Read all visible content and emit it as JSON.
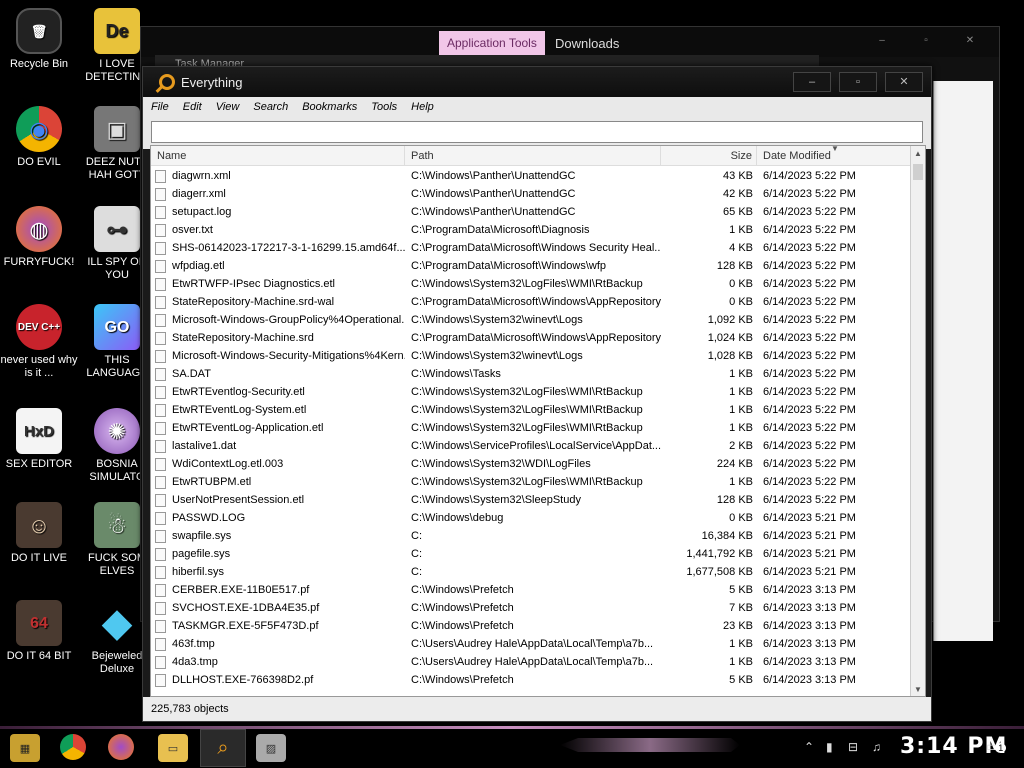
{
  "desktop": {
    "icons": [
      {
        "label": "Recycle Bin",
        "glyph": "🗑"
      },
      {
        "label": "I LOVE DETECTING",
        "glyph": "De"
      },
      {
        "label": "DO EVIL",
        "glyph": "◉"
      },
      {
        "label": "DEEZ NUTS HAH GOTT",
        "glyph": "▣"
      },
      {
        "label": "FURRYFUCK!",
        "glyph": "◍"
      },
      {
        "label": "ILL SPY ON YOU",
        "glyph": "⊶"
      },
      {
        "label": "never used why is it ...",
        "glyph": "DEV C++"
      },
      {
        "label": "THIS LANGUAGE",
        "glyph": "GO"
      },
      {
        "label": "SEX EDITOR",
        "glyph": "HxD"
      },
      {
        "label": "BOSNIA SIMULATO",
        "glyph": "✺"
      },
      {
        "label": "DO IT LIVE",
        "glyph": "☺"
      },
      {
        "label": "FUCK SOM ELVES",
        "glyph": "☃"
      },
      {
        "label": "DO IT 64 BIT",
        "glyph": "64"
      },
      {
        "label": "Bejeweled Deluxe",
        "glyph": "◆"
      }
    ]
  },
  "bg_window": {
    "tab_application_tools": "Application Tools",
    "tab_downloads": "Downloads",
    "task_manager_title": "Task Manager"
  },
  "everything": {
    "title": "Everything",
    "window_controls": {
      "minimize": "–",
      "maximize": "▫",
      "close": "✕"
    },
    "menu": [
      "File",
      "Edit",
      "View",
      "Search",
      "Bookmarks",
      "Tools",
      "Help"
    ],
    "search": {
      "value": "",
      "placeholder": ""
    },
    "columns": {
      "name": "Name",
      "path": "Path",
      "size": "Size",
      "date": "Date Modified"
    },
    "rows": [
      {
        "name": "diagwrn.xml",
        "path": "C:\\Windows\\Panther\\UnattendGC",
        "size": "43 KB",
        "date": "6/14/2023 5:22 PM"
      },
      {
        "name": "diagerr.xml",
        "path": "C:\\Windows\\Panther\\UnattendGC",
        "size": "42 KB",
        "date": "6/14/2023 5:22 PM"
      },
      {
        "name": "setupact.log",
        "path": "C:\\Windows\\Panther\\UnattendGC",
        "size": "65 KB",
        "date": "6/14/2023 5:22 PM"
      },
      {
        "name": "osver.txt",
        "path": "C:\\ProgramData\\Microsoft\\Diagnosis",
        "size": "1 KB",
        "date": "6/14/2023 5:22 PM"
      },
      {
        "name": "SHS-06142023-172217-3-1-16299.15.amd64f...",
        "path": "C:\\ProgramData\\Microsoft\\Windows Security Heal...",
        "size": "4 KB",
        "date": "6/14/2023 5:22 PM"
      },
      {
        "name": "wfpdiag.etl",
        "path": "C:\\ProgramData\\Microsoft\\Windows\\wfp",
        "size": "128 KB",
        "date": "6/14/2023 5:22 PM"
      },
      {
        "name": "EtwRTWFP-IPsec Diagnostics.etl",
        "path": "C:\\Windows\\System32\\LogFiles\\WMI\\RtBackup",
        "size": "0 KB",
        "date": "6/14/2023 5:22 PM"
      },
      {
        "name": "StateRepository-Machine.srd-wal",
        "path": "C:\\ProgramData\\Microsoft\\Windows\\AppRepository",
        "size": "0 KB",
        "date": "6/14/2023 5:22 PM"
      },
      {
        "name": "Microsoft-Windows-GroupPolicy%4Operational...",
        "path": "C:\\Windows\\System32\\winevt\\Logs",
        "size": "1,092 KB",
        "date": "6/14/2023 5:22 PM"
      },
      {
        "name": "StateRepository-Machine.srd",
        "path": "C:\\ProgramData\\Microsoft\\Windows\\AppRepository",
        "size": "1,024 KB",
        "date": "6/14/2023 5:22 PM"
      },
      {
        "name": "Microsoft-Windows-Security-Mitigations%4Kern...",
        "path": "C:\\Windows\\System32\\winevt\\Logs",
        "size": "1,028 KB",
        "date": "6/14/2023 5:22 PM"
      },
      {
        "name": "SA.DAT",
        "path": "C:\\Windows\\Tasks",
        "size": "1 KB",
        "date": "6/14/2023 5:22 PM"
      },
      {
        "name": "EtwRTEventlog-Security.etl",
        "path": "C:\\Windows\\System32\\LogFiles\\WMI\\RtBackup",
        "size": "1 KB",
        "date": "6/14/2023 5:22 PM"
      },
      {
        "name": "EtwRTEventLog-System.etl",
        "path": "C:\\Windows\\System32\\LogFiles\\WMI\\RtBackup",
        "size": "1 KB",
        "date": "6/14/2023 5:22 PM"
      },
      {
        "name": "EtwRTEventLog-Application.etl",
        "path": "C:\\Windows\\System32\\LogFiles\\WMI\\RtBackup",
        "size": "1 KB",
        "date": "6/14/2023 5:22 PM"
      },
      {
        "name": "lastalive1.dat",
        "path": "C:\\Windows\\ServiceProfiles\\LocalService\\AppDat...",
        "size": "2 KB",
        "date": "6/14/2023 5:22 PM"
      },
      {
        "name": "WdiContextLog.etl.003",
        "path": "C:\\Windows\\System32\\WDI\\LogFiles",
        "size": "224 KB",
        "date": "6/14/2023 5:22 PM"
      },
      {
        "name": "EtwRTUBPM.etl",
        "path": "C:\\Windows\\System32\\LogFiles\\WMI\\RtBackup",
        "size": "1 KB",
        "date": "6/14/2023 5:22 PM"
      },
      {
        "name": "UserNotPresentSession.etl",
        "path": "C:\\Windows\\System32\\SleepStudy",
        "size": "128 KB",
        "date": "6/14/2023 5:22 PM"
      },
      {
        "name": "PASSWD.LOG",
        "path": "C:\\Windows\\debug",
        "size": "0 KB",
        "date": "6/14/2023 5:21 PM"
      },
      {
        "name": "swapfile.sys",
        "path": "C:",
        "size": "16,384 KB",
        "date": "6/14/2023 5:21 PM"
      },
      {
        "name": "pagefile.sys",
        "path": "C:",
        "size": "1,441,792 KB",
        "date": "6/14/2023 5:21 PM"
      },
      {
        "name": "hiberfil.sys",
        "path": "C:",
        "size": "1,677,508 KB",
        "date": "6/14/2023 5:21 PM"
      },
      {
        "name": "CERBER.EXE-11B0E517.pf",
        "path": "C:\\Windows\\Prefetch",
        "size": "5 KB",
        "date": "6/14/2023 3:13 PM"
      },
      {
        "name": "SVCHOST.EXE-1DBA4E35.pf",
        "path": "C:\\Windows\\Prefetch",
        "size": "7 KB",
        "date": "6/14/2023 3:13 PM"
      },
      {
        "name": "TASKMGR.EXE-5F5F473D.pf",
        "path": "C:\\Windows\\Prefetch",
        "size": "23 KB",
        "date": "6/14/2023 3:13 PM"
      },
      {
        "name": "463f.tmp",
        "path": "C:\\Users\\Audrey Hale\\AppData\\Local\\Temp\\a7b...",
        "size": "1 KB",
        "date": "6/14/2023 3:13 PM"
      },
      {
        "name": "4da3.tmp",
        "path": "C:\\Users\\Audrey Hale\\AppData\\Local\\Temp\\a7b...",
        "size": "1 KB",
        "date": "6/14/2023 3:13 PM"
      },
      {
        "name": "DLLHOST.EXE-766398D2.pf",
        "path": "C:\\Windows\\Prefetch",
        "size": "5 KB",
        "date": "6/14/2023 3:13 PM"
      }
    ],
    "status": "225,783 objects"
  },
  "taskbar": {
    "clock": "3:14 PM",
    "notification_count": "1",
    "accent": "#c890c0"
  }
}
